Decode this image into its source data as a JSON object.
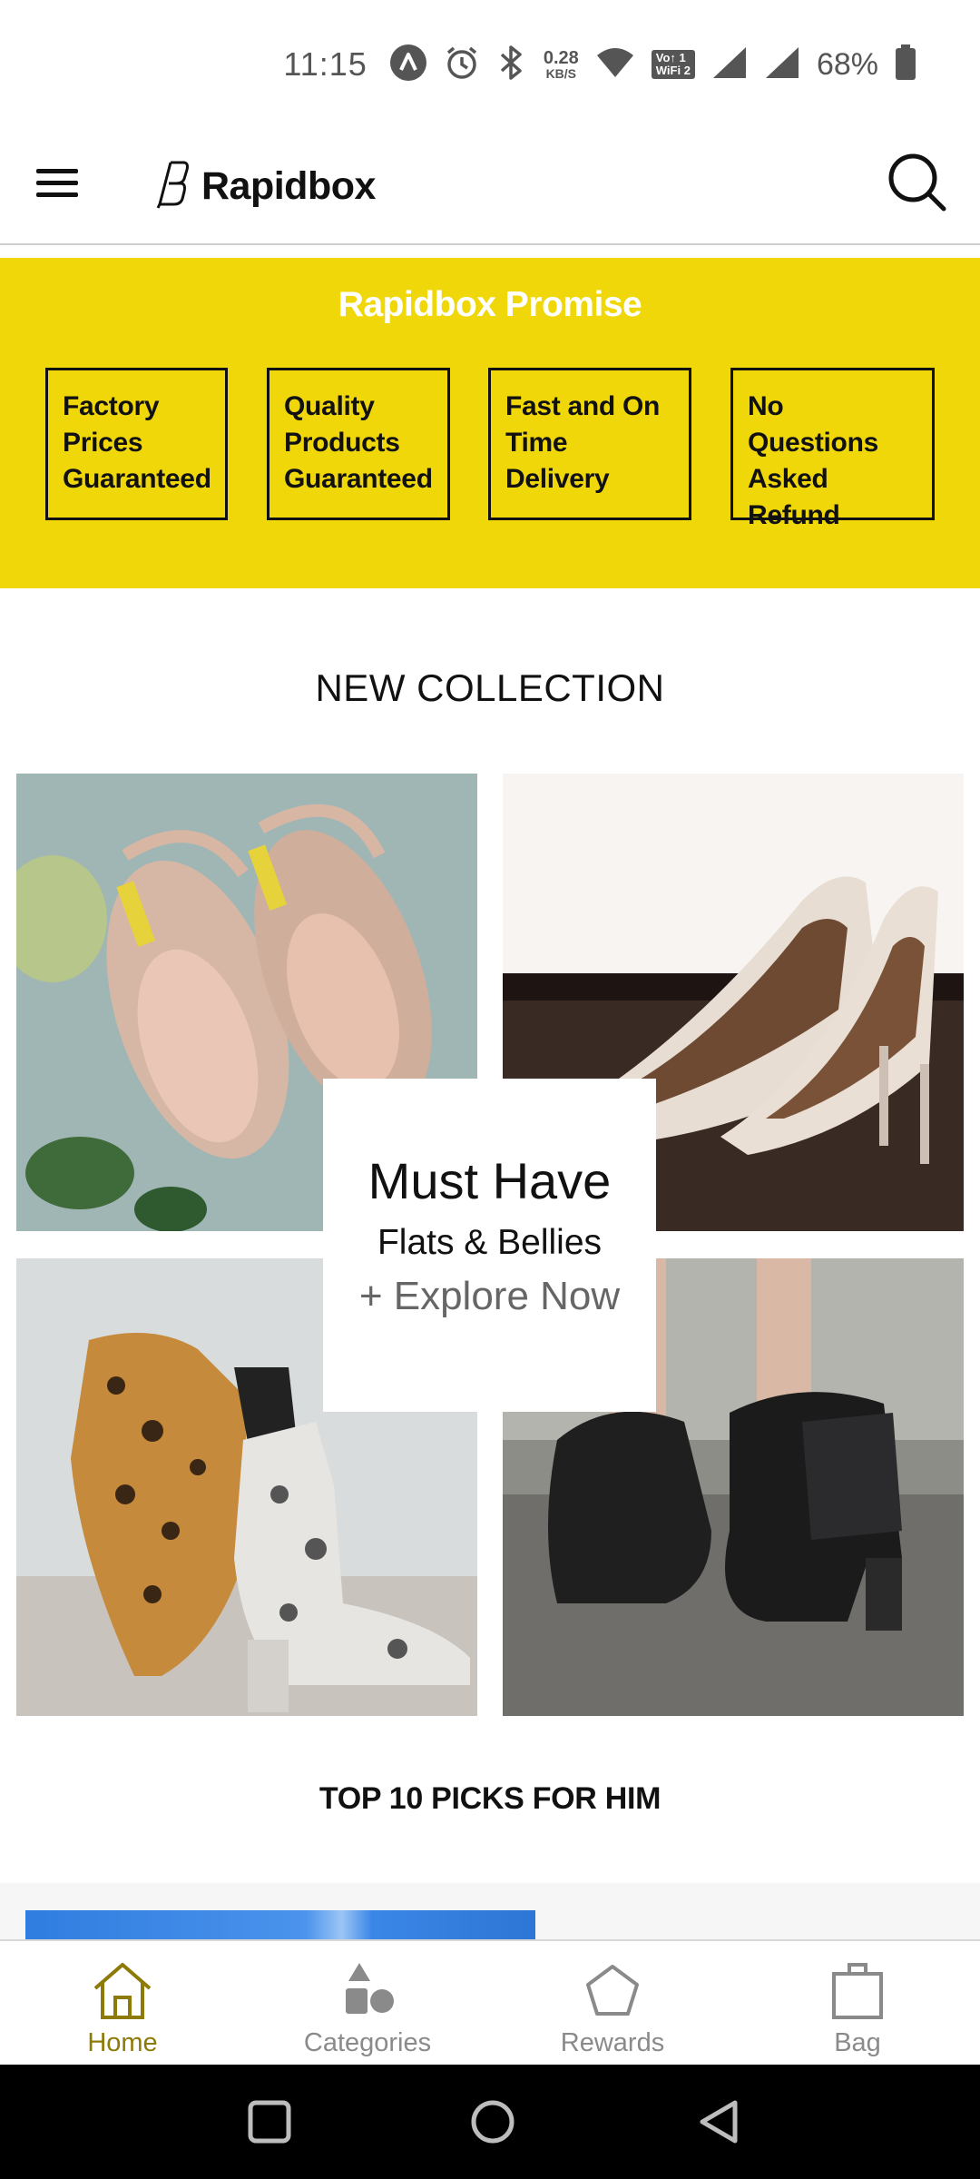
{
  "status_bar": {
    "time": "11:15",
    "net_speed_value": "0.28",
    "net_speed_unit": "KB/S",
    "vowifi_line1": "Vo↑ 1",
    "vowifi_line2": "WiFi 2",
    "battery": "68%",
    "icons": [
      "app-notification-icon",
      "alarm-icon",
      "bluetooth-icon",
      "wifi-icon",
      "signal-icon",
      "battery-icon"
    ]
  },
  "header": {
    "app_name": "Rapidbox",
    "icons": [
      "menu-icon",
      "logo-icon",
      "search-icon"
    ]
  },
  "promise": {
    "title": "Rapidbox Promise",
    "items": [
      {
        "lines": [
          "Factory",
          "Prices",
          "Guaranteed"
        ]
      },
      {
        "lines": [
          "Quality",
          "Products",
          "Guaranteed"
        ]
      },
      {
        "lines": [
          "Fast and On",
          "Time Delivery"
        ]
      },
      {
        "lines": [
          "No Questions",
          "Asked",
          "Refund"
        ]
      }
    ]
  },
  "collection": {
    "heading": "NEW COLLECTION",
    "overlay": {
      "title": "Must Have",
      "subtitle": "Flats & Bellies",
      "cta": "+ Explore Now"
    },
    "tiles": [
      "strappy-heels-image",
      "nude-pumps-image",
      "animal-print-boots-image",
      "black-ankle-boots-image"
    ]
  },
  "picks": {
    "heading": "TOP 10 PICKS FOR HIM"
  },
  "bottom_nav": {
    "items": [
      {
        "label": "Home",
        "icon": "home-icon",
        "active": true
      },
      {
        "label": "Categories",
        "icon": "categories-icon",
        "active": false
      },
      {
        "label": "Rewards",
        "icon": "rewards-icon",
        "active": false
      },
      {
        "label": "Bag",
        "icon": "bag-icon",
        "active": false
      }
    ]
  },
  "colors": {
    "promise_bg": "#f0d70a",
    "accent": "#8d7a07",
    "nav_inactive": "#8a8a8a"
  }
}
